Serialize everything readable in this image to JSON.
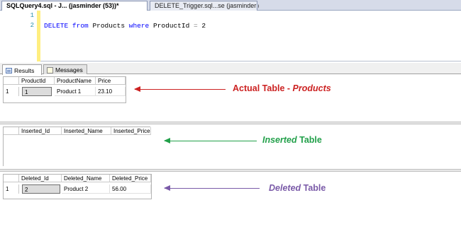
{
  "doc_tabs": [
    {
      "label": "SQLQuery4.sql - J... (jasminder (53))*",
      "active": true
    },
    {
      "label": "DELETE_Trigger.sql...se (jasminder (54))",
      "active": false
    }
  ],
  "editor": {
    "line_numbers": [
      "1",
      "2"
    ],
    "code": {
      "kw1": "DELETE",
      "kw2": "from",
      "table": "Products",
      "kw3": "where",
      "column": "ProductId",
      "op": "=",
      "value": "2"
    }
  },
  "results_tabs": [
    {
      "label": "Results",
      "active": true
    },
    {
      "label": "Messages",
      "active": false
    }
  ],
  "grids": [
    {
      "columns": [
        "ProductId",
        "ProductName",
        "Price"
      ],
      "rows": [
        {
          "num": "1",
          "cells": [
            "1",
            "Product 1",
            "23.10"
          ]
        }
      ],
      "annotation": {
        "prefix": "Actual Table - ",
        "emphasis": "Products",
        "suffix": "",
        "color": "#cc2222"
      }
    },
    {
      "columns": [
        "Inserted_Id",
        "Inserted_Name",
        "Inserted_Price"
      ],
      "rows": [],
      "annotation": {
        "prefix": "",
        "emphasis": "Inserted",
        "suffix": " Table",
        "color": "#22a04a"
      }
    },
    {
      "columns": [
        "Deleted_Id",
        "Deleted_Name",
        "Deleted_Price"
      ],
      "rows": [
        {
          "num": "1",
          "cells": [
            "2",
            "Product 2",
            "56.00"
          ]
        }
      ],
      "annotation": {
        "prefix": "",
        "emphasis": "Deleted",
        "suffix": " Table",
        "color": "#7a5aa8"
      }
    }
  ]
}
